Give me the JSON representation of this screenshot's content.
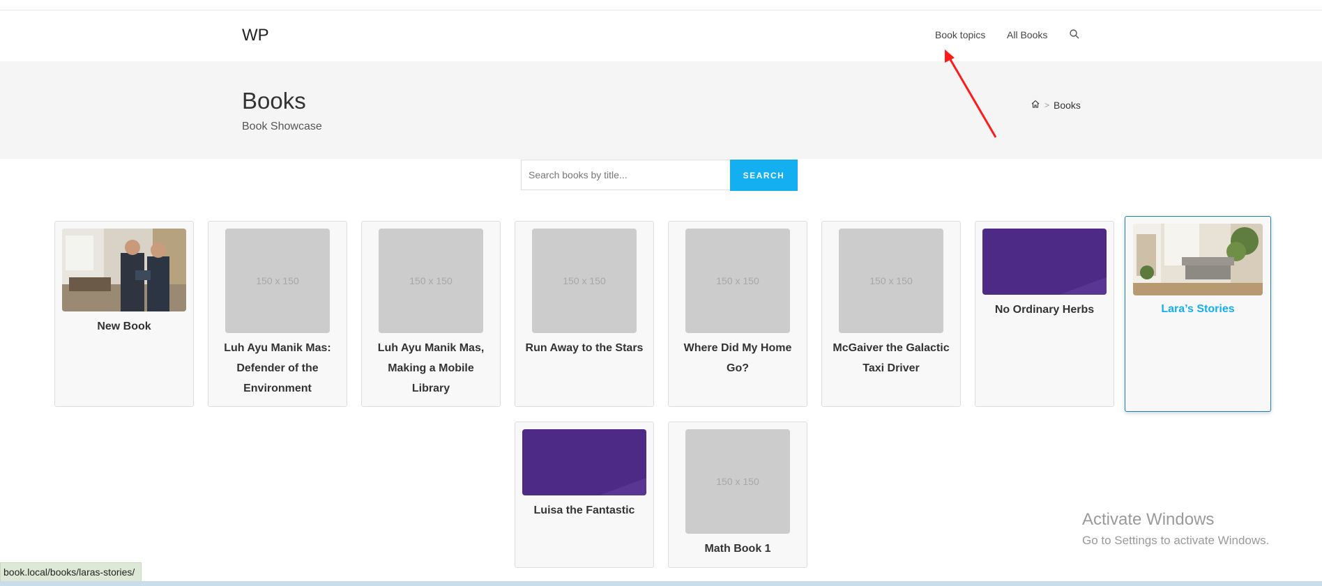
{
  "header": {
    "logo": "WP",
    "nav": [
      {
        "label": "Book topics"
      },
      {
        "label": "All Books"
      }
    ],
    "search_icon": "search-icon"
  },
  "hero": {
    "title": "Books",
    "subtitle": "Book Showcase",
    "breadcrumb": {
      "home_icon": "home-icon",
      "separator": ">",
      "current": "Books"
    }
  },
  "search": {
    "placeholder": "Search books by title...",
    "button_label": "SEARCH"
  },
  "books": [
    {
      "title": "New Book",
      "thumb": "photo-office-meeting"
    },
    {
      "title": "Luh Ayu Manik Mas: Defender of the Environment",
      "thumb": "150 x 150"
    },
    {
      "title": "Luh Ayu Manik Mas, Making a Mobile Library",
      "thumb": "150 x 150"
    },
    {
      "title": "Run Away to the Stars",
      "thumb": "150 x 150"
    },
    {
      "title": "Where Did My Home Go?",
      "thumb": "150 x 150"
    },
    {
      "title": "McGaiver the Galactic Taxi Driver",
      "thumb": "150 x 150"
    },
    {
      "title": "No Ordinary Herbs",
      "thumb": "purple-cover"
    },
    {
      "title": "Lara’s Stories",
      "thumb": "photo-living-room"
    },
    {
      "title": "Luisa the Fantastic",
      "thumb": "purple-cover"
    },
    {
      "title": "Math Book 1",
      "thumb": "150 x 150"
    }
  ],
  "status_bar": {
    "url": "book.local/books/laras-stories/"
  },
  "watermark": {
    "line1": "Activate Windows",
    "line2": "Go to Settings to activate Windows."
  },
  "annotation": {
    "type": "red-arrow",
    "color": "#ff1a1a",
    "points_to": "Book topics"
  }
}
